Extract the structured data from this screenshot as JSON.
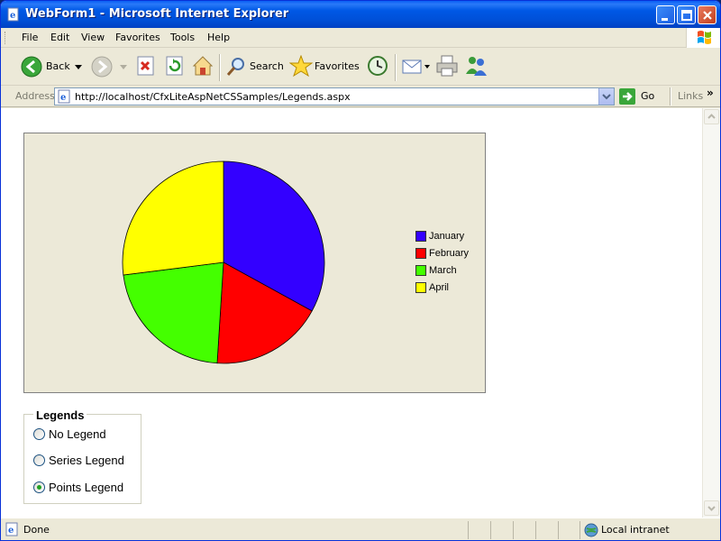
{
  "window": {
    "title": "WebForm1 - Microsoft Internet Explorer"
  },
  "menubar": {
    "items": [
      "File",
      "Edit",
      "View",
      "Favorites",
      "Tools",
      "Help"
    ]
  },
  "toolbar": {
    "back_label": "Back",
    "search_label": "Search",
    "favorites_label": "Favorites"
  },
  "addressbar": {
    "label": "Address",
    "url": "http://localhost/CfxLiteAspNetCSSamples/Legends.aspx",
    "go_label": "Go",
    "links_label": "Links"
  },
  "chart_data": {
    "type": "pie",
    "categories": [
      "January",
      "February",
      "March",
      "April"
    ],
    "values": [
      33,
      18,
      22,
      27
    ],
    "colors": [
      "#3300ff",
      "#ff0000",
      "#44ff00",
      "#ffff00"
    ],
    "legend_position": "right"
  },
  "legends_group": {
    "title": "Legends",
    "options": [
      "No Legend",
      "Series Legend",
      "Points Legend"
    ],
    "selected": "Points Legend"
  },
  "statusbar": {
    "status": "Done",
    "zone": "Local intranet"
  }
}
